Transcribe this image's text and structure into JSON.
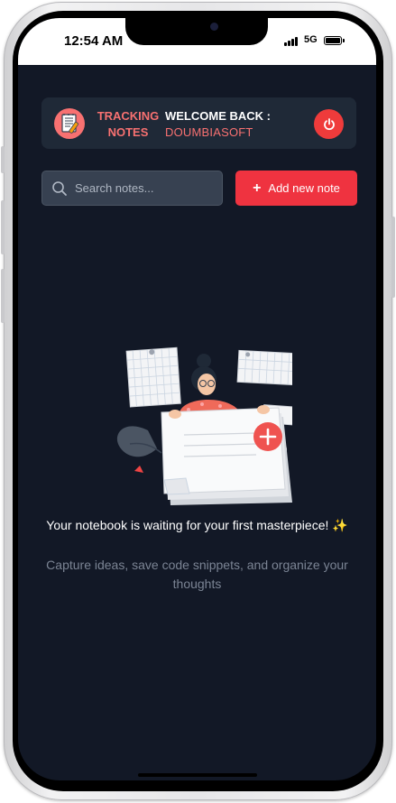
{
  "status_bar": {
    "time": "12:54 AM",
    "network": "5G"
  },
  "header": {
    "brand_line1": "TRACKING",
    "brand_line2": "NOTES",
    "welcome_title": "WELCOME BACK :",
    "username": "DOUMBIASOFT",
    "logout_icon": "power-icon"
  },
  "search": {
    "placeholder": "Search notes...",
    "value": "",
    "icon": "search-icon"
  },
  "add_button": {
    "label": "Add new note",
    "icon": "plus-icon"
  },
  "empty_state": {
    "title": "Your notebook is waiting for your first masterpiece! ✨",
    "subtitle": "Capture ideas, save code snippets, and organize your thoughts"
  },
  "colors": {
    "background": "#121826",
    "card": "#1f2937",
    "accent": "#ef3340",
    "brand": "#f87171"
  }
}
